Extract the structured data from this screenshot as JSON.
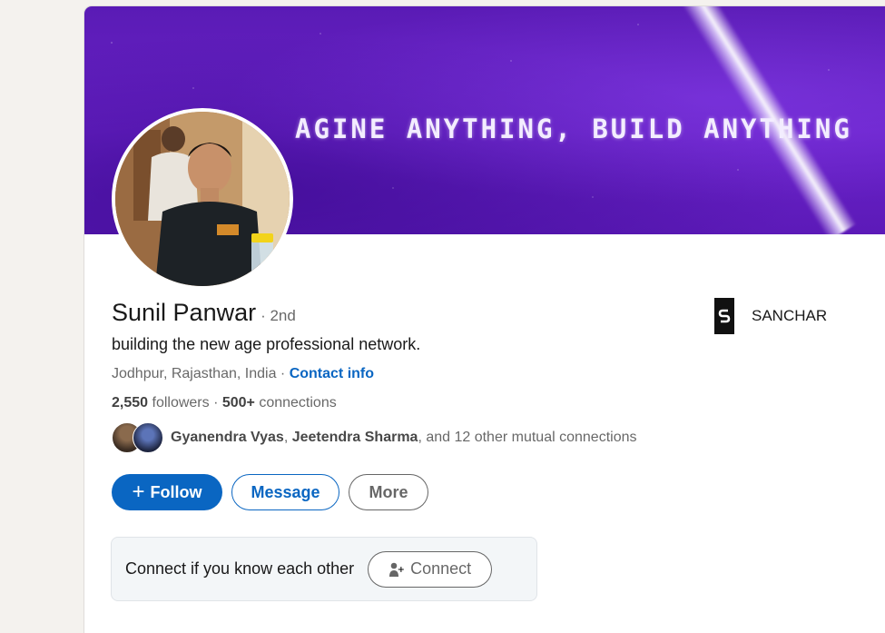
{
  "banner": {
    "tagline": "AGINE ANYTHING, BUILD ANYTHING"
  },
  "profile": {
    "name": "Sunil Panwar",
    "degree": "· 2nd",
    "headline": "building the new age professional network.",
    "location": "Jodhpur, Rajasthan, India",
    "location_separator": " · ",
    "contact_info_label": "Contact info",
    "followers_count": "2,550",
    "followers_label": " followers",
    "connections_separator": "  · ",
    "connections_count": "500+",
    "connections_label": " connections"
  },
  "mutual": {
    "name1": "Gyanendra Vyas",
    "sep": ", ",
    "name2": "Jeetendra Sharma",
    "rest": ", and 12 other mutual connections"
  },
  "actions": {
    "follow_label": "Follow",
    "follow_icon": "+",
    "message_label": "Message",
    "more_label": "More"
  },
  "connect_box": {
    "text": "Connect if you know each other",
    "button_label": "Connect"
  },
  "company": {
    "name": "SANCHAR",
    "logo_letter": "S"
  },
  "colors": {
    "accent": "#0a66c2",
    "banner": "#6a22c9",
    "page_bg": "#f4f2ee"
  }
}
